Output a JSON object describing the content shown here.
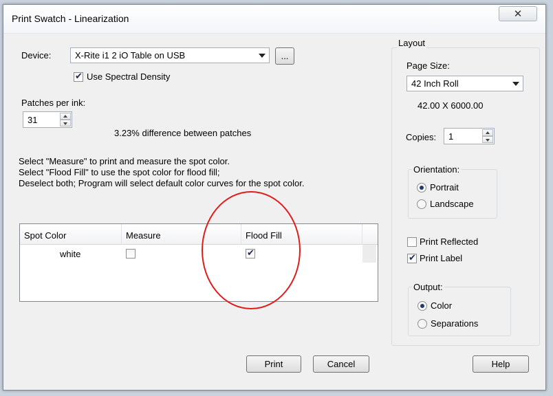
{
  "window": {
    "title": "Print Swatch - Linearization",
    "close_icon": "close-icon"
  },
  "device": {
    "label": "Device:",
    "selected": "X-Rite i1 2 iO Table on USB",
    "browse_label": "...",
    "spectral_label": "Use Spectral Density",
    "spectral_checked": true
  },
  "patches": {
    "label": "Patches per ink:",
    "value": "31",
    "difference_text": "3.23% difference between patches"
  },
  "instructions": [
    "Select \"Measure\" to print and measure the spot color.",
    "Select \"Flood Fill\" to use the spot color for flood fill;",
    "Deselect both; Program will select default color curves for the spot color."
  ],
  "spot_table": {
    "columns": [
      "Spot Color",
      "Measure",
      "Flood Fill"
    ],
    "rows": [
      {
        "name": "white",
        "measure": false,
        "flood_fill": true
      }
    ]
  },
  "layout": {
    "group_title": "Layout",
    "page_size_label": "Page Size:",
    "page_size_value": "42 Inch Roll",
    "dimensions": "42.00 X 6000.00",
    "copies_label": "Copies:",
    "copies_value": "1",
    "orientation": {
      "title": "Orientation:",
      "options": [
        "Portrait",
        "Landscape"
      ],
      "selected": "Portrait"
    },
    "print_reflected_label": "Print Reflected",
    "print_reflected_checked": false,
    "print_label_label": "Print Label",
    "print_label_checked": true,
    "output": {
      "title": "Output:",
      "options": [
        "Color",
        "Separations"
      ],
      "selected": "Color"
    }
  },
  "buttons": {
    "print": "Print",
    "cancel": "Cancel",
    "help": "Help"
  },
  "colors": {
    "annotation_circle": "#e01b1b",
    "dialog_bg": "#f0f0f0"
  }
}
